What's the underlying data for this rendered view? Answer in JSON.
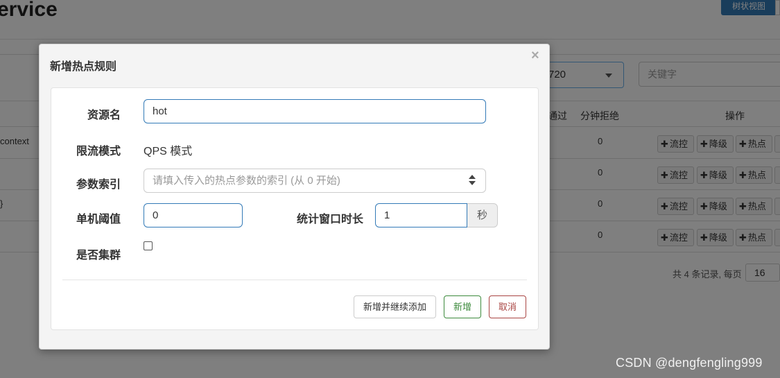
{
  "background": {
    "page_title": "ervice",
    "tree_view_button": "树状视图",
    "machine_select_value": "720",
    "keyword_placeholder": "关键字",
    "table_headers": {
      "pass": "通过",
      "minute_reject": "分钟拒绝",
      "operations": "操作"
    },
    "rows": [
      {
        "resource": "context",
        "minute_reject": "0"
      },
      {
        "resource": "",
        "minute_reject": "0"
      },
      {
        "resource": "}",
        "minute_reject": "0"
      },
      {
        "resource": "",
        "minute_reject": "0"
      }
    ],
    "op_buttons": {
      "flow": "流控",
      "degrade": "降级",
      "hot": "热点"
    },
    "pager_text": "共 4 条记录, 每页",
    "page_size": "16"
  },
  "modal": {
    "title": "新增热点规则",
    "close_symbol": "×",
    "fields": {
      "resource_label": "资源名",
      "resource_value": "hot",
      "mode_label": "限流模式",
      "mode_value": "QPS 模式",
      "param_index_label": "参数索引",
      "param_index_placeholder": "请填入传入的热点参数的索引 (从 0 开始)",
      "threshold_label": "单机阈值",
      "threshold_value": "0",
      "window_label": "统计窗口时长",
      "window_value": "1",
      "window_unit": "秒",
      "cluster_label": "是否集群",
      "cluster_checked": false
    },
    "buttons": {
      "add_and_continue": "新增并继续添加",
      "add": "新增",
      "cancel": "取消"
    }
  },
  "watermark": "CSDN @dengfengling999",
  "colors": {
    "primary": "#337ab7",
    "success": "#3c8a3c",
    "danger": "#a94442"
  }
}
